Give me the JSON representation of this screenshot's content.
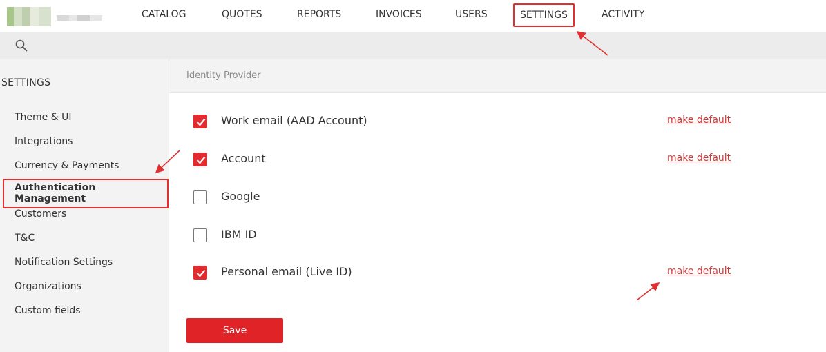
{
  "nav": {
    "items": [
      "CATALOG",
      "QUOTES",
      "REPORTS",
      "INVOICES",
      "USERS",
      "SETTINGS",
      "ACTIVITY"
    ],
    "active": "SETTINGS"
  },
  "search": {
    "icon": "search-icon"
  },
  "sidebar": {
    "title": "SETTINGS",
    "items": [
      "Theme & UI",
      "Integrations",
      "Currency & Payments",
      "Authentication Management",
      "Customers",
      "T&C",
      "Notification Settings",
      "Organizations",
      "Custom fields"
    ],
    "active": "Authentication Management"
  },
  "main": {
    "header": "Identity Provider",
    "providers": [
      {
        "label": "Work email (AAD Account)",
        "checked": true,
        "action": "make default"
      },
      {
        "label": "Account",
        "checked": true,
        "action": "make default"
      },
      {
        "label": "Google",
        "checked": false,
        "action": ""
      },
      {
        "label": "IBM ID",
        "checked": false,
        "action": ""
      },
      {
        "label": "Personal email (Live ID)",
        "checked": true,
        "action": "make default"
      }
    ],
    "save_label": "Save"
  },
  "colors": {
    "accent": "#e02327",
    "link": "#d23a3a",
    "sidebar_bg": "#f3f3f3",
    "annotation": "#e03030"
  }
}
